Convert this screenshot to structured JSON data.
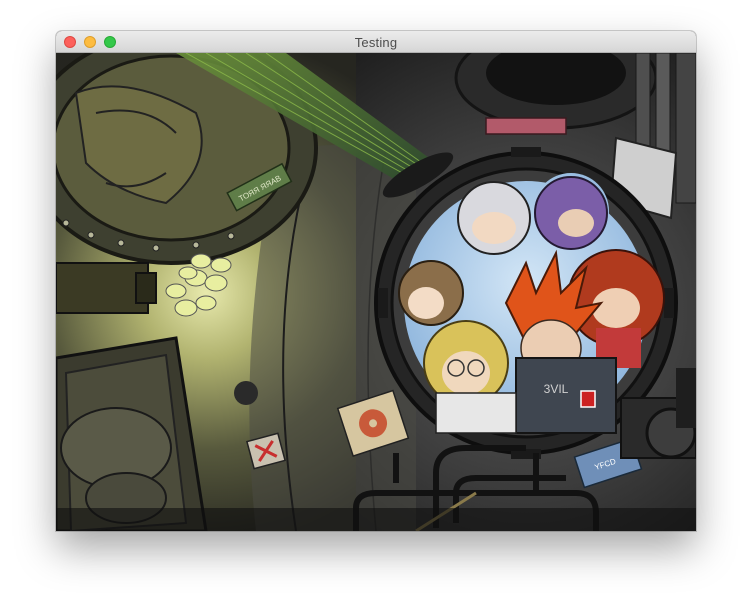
{
  "window": {
    "title": "Testing",
    "buttons": [
      "close",
      "minimize",
      "zoom"
    ]
  },
  "artwork": {
    "signs": {
      "sticker_left": "ТОЯЯ ЯЯАВ",
      "sticker_right": "YFCD",
      "shirt_text": "3VIL"
    }
  },
  "colors": {
    "lamp_glow": "#e8eea0",
    "sky": "#9fc4e6",
    "hair_orange": "#e0541a",
    "hair_red": "#b03a1e",
    "hair_purple": "#7b5ea8",
    "hair_blond": "#d9c25a"
  }
}
